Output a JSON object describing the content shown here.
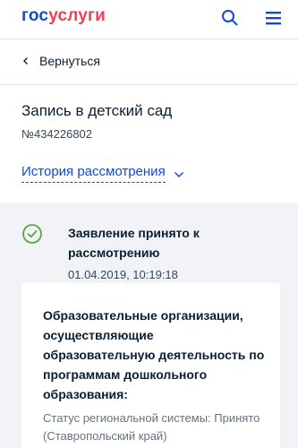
{
  "header": {
    "logo_part1": "гос",
    "logo_part2": "услуги",
    "icons": {
      "search": "search-icon",
      "menu": "menu-icon"
    }
  },
  "nav": {
    "back_label": "Вернуться"
  },
  "application": {
    "title": "Запись в детский сад",
    "number": "№434226802",
    "history_link": "История рассмотрения"
  },
  "status": {
    "title": "Заявление принято к рассмотрению",
    "date": "01.04.2019, 10:19:18",
    "icon": "check-circle-icon"
  },
  "card": {
    "title": "Образовательные организации, осуществляющие образовательную деятельность по программам дошкольного образования:",
    "status_text": "Статус региональной системы: Принято (Ставропольский край)"
  },
  "colors": {
    "brand_blue": "#0d4cd3",
    "brand_red": "#ee3f58",
    "success_green": "#5aa641",
    "panel_bg": "#f1f3f6"
  }
}
